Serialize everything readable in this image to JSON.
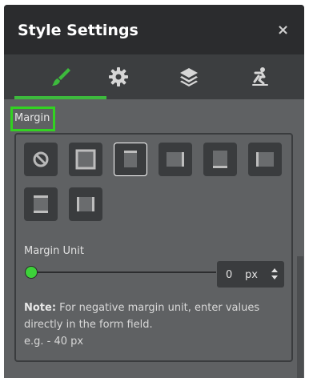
{
  "header": {
    "title": "Style Settings",
    "close_label": "×"
  },
  "tabs": [
    {
      "icon": "brush-icon",
      "active": true
    },
    {
      "icon": "gear-icon",
      "active": false
    },
    {
      "icon": "layers-icon",
      "active": false
    },
    {
      "icon": "skater-icon",
      "active": false
    }
  ],
  "margin_section": {
    "label": "Margin",
    "options": [
      {
        "icon": "no-margin-icon",
        "selected": false
      },
      {
        "icon": "margin-all-icon",
        "selected": false
      },
      {
        "icon": "margin-top-icon",
        "selected": true
      },
      {
        "icon": "margin-right-icon",
        "selected": false
      },
      {
        "icon": "margin-bottom-icon",
        "selected": false
      },
      {
        "icon": "margin-left-icon",
        "selected": false
      },
      {
        "icon": "margin-vertical-icon",
        "selected": false
      },
      {
        "icon": "margin-horizontal-icon",
        "selected": false
      }
    ],
    "unit_label": "Margin Unit",
    "slider_value": 0,
    "value": "0",
    "unit": "px",
    "note_strong": "Note:",
    "note_line1": " For negative margin unit, enter values",
    "note_line2": "directly in the form field.",
    "note_line3": "e.g. - 40 px"
  },
  "colors": {
    "accent": "#3dba3d",
    "highlight_box": "#32d321",
    "panel_bg": "#5f6163",
    "header_bg": "#2b2c2e"
  }
}
